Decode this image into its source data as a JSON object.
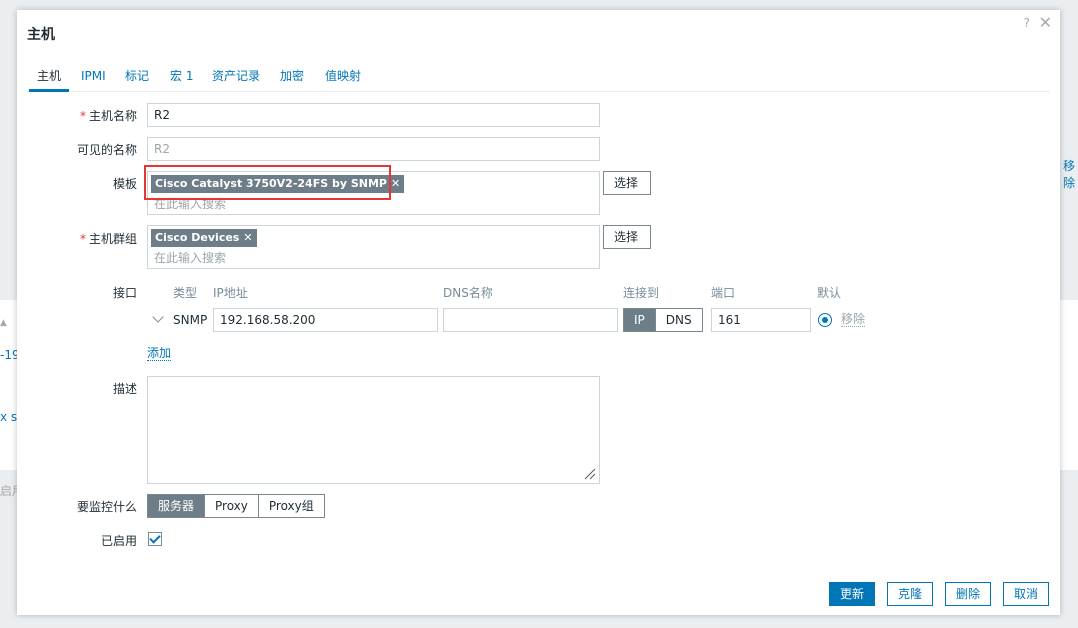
{
  "background": {
    "fragment_remove": "移除",
    "fragment_num": "-19",
    "fragment_x": "x s",
    "fragment_enable": "启用"
  },
  "dialog": {
    "title": "主机",
    "help_icon": "?",
    "close_icon": "✕"
  },
  "tabs": [
    "主机",
    "IPMI",
    "标记",
    "宏 1",
    "资产记录",
    "加密",
    "值映射"
  ],
  "form": {
    "host_name_label": "主机名称",
    "host_name_value": "R2",
    "visible_name_label": "可见的名称",
    "visible_name_placeholder": "R2",
    "templates_label": "模板",
    "template_chip": "Cisco Catalyst 3750V2-24FS by SNMP",
    "template_search_placeholder": "在此输入搜索",
    "select_button": "选择",
    "groups_label": "主机群组",
    "group_chip": "Cisco Devices",
    "group_search_placeholder": "在此输入搜索",
    "required_mark": "*",
    "chip_remove": "✕"
  },
  "interfaces": {
    "label": "接口",
    "headers": {
      "type": "类型",
      "ip": "IP地址",
      "dns": "DNS名称",
      "connect_to": "连接到",
      "port": "端口",
      "default": "默认"
    },
    "row": {
      "type": "SNMP",
      "ip": "192.168.58.200",
      "dns": "",
      "connect_ip": "IP",
      "connect_dns": "DNS",
      "port": "161",
      "remove": "移除"
    },
    "add": "添加"
  },
  "description": {
    "label": "描述",
    "value": ""
  },
  "monitored_by": {
    "label": "要监控什么",
    "options": [
      "服务器",
      "Proxy",
      "Proxy组"
    ],
    "selected": "服务器"
  },
  "enabled": {
    "label": "已启用",
    "checked": true
  },
  "footer": {
    "update": "更新",
    "clone": "克隆",
    "delete": "删除",
    "cancel": "取消"
  }
}
